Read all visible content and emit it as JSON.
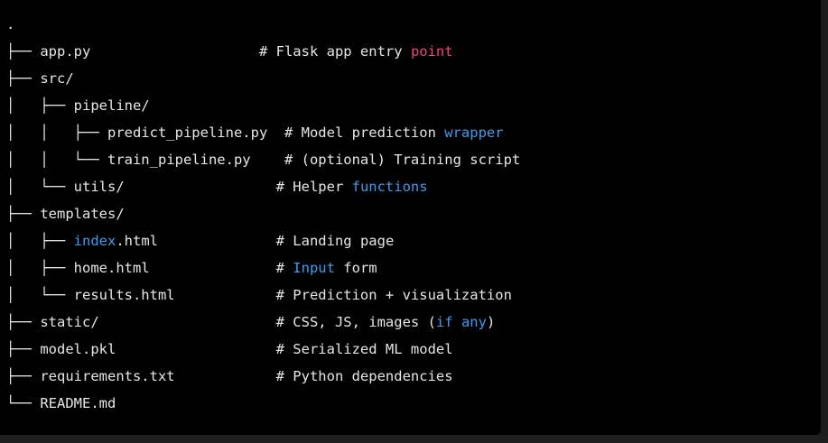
{
  "colors": {
    "default_text": "#e6e6e6",
    "keyword_pink": "#f0437a",
    "keyword_blue": "#3d9bf0",
    "background": "#000000"
  },
  "code": {
    "lines": [
      [
        {
          "text": ".",
          "color": "#e6e6e6"
        }
      ],
      [
        {
          "text": "├── app.py                    # Flask app entry ",
          "color": "#e6e6e6"
        },
        {
          "text": "point",
          "color": "#f0437a"
        }
      ],
      [
        {
          "text": "├── src/",
          "color": "#e6e6e6"
        }
      ],
      [
        {
          "text": "│   ├── pipeline/",
          "color": "#e6e6e6"
        }
      ],
      [
        {
          "text": "│   │   ├── predict_pipeline.py  # Model prediction ",
          "color": "#e6e6e6"
        },
        {
          "text": "wrapper",
          "color": "#3d9bf0"
        }
      ],
      [
        {
          "text": "│   │   └── train_pipeline.py    # (optional) Training script",
          "color": "#e6e6e6"
        }
      ],
      [
        {
          "text": "│   └── utils/                  # Helper ",
          "color": "#e6e6e6"
        },
        {
          "text": "functions",
          "color": "#3d9bf0"
        }
      ],
      [
        {
          "text": "├── templates/",
          "color": "#e6e6e6"
        }
      ],
      [
        {
          "text": "│   ├── ",
          "color": "#e6e6e6"
        },
        {
          "text": "index",
          "color": "#3d9bf0"
        },
        {
          "text": ".html              # Landing page",
          "color": "#e6e6e6"
        }
      ],
      [
        {
          "text": "│   ├── home.html               # ",
          "color": "#e6e6e6"
        },
        {
          "text": "Input",
          "color": "#3d9bf0"
        },
        {
          "text": " form",
          "color": "#e6e6e6"
        }
      ],
      [
        {
          "text": "│   └── results.html            # Prediction + visualization",
          "color": "#e6e6e6"
        }
      ],
      [
        {
          "text": "├── static/                     # CSS, JS, images (",
          "color": "#e6e6e6"
        },
        {
          "text": "if",
          "color": "#3d9bf0"
        },
        {
          "text": " ",
          "color": "#e6e6e6"
        },
        {
          "text": "any",
          "color": "#3d9bf0"
        },
        {
          "text": ")",
          "color": "#e6e6e6"
        }
      ],
      [
        {
          "text": "├── model.pkl                   # Serialized ML model",
          "color": "#e6e6e6"
        }
      ],
      [
        {
          "text": "├── requirements.txt            # Python dependencies",
          "color": "#e6e6e6"
        }
      ],
      [
        {
          "text": "└── README.md",
          "color": "#e6e6e6"
        }
      ]
    ]
  }
}
